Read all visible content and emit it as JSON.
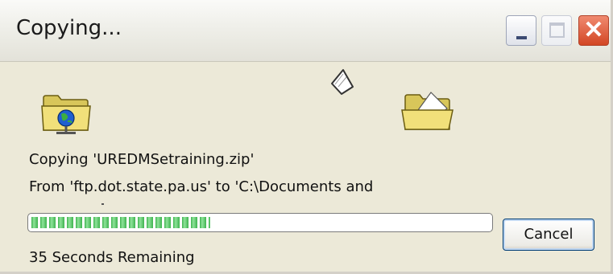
{
  "window": {
    "title": "Copying..."
  },
  "titlebar_buttons": {
    "minimize_icon": "minimize-icon",
    "maximize_icon": "maximize-icon",
    "close_icon": "close-icon",
    "close_glyph": "✕"
  },
  "animation": {
    "source_icon": "ftp-folder-icon",
    "flying_icon": "document-icon",
    "destination_icon": "open-folder-icon"
  },
  "status": {
    "copying_line": "Copying 'UREDMSetraining.zip'",
    "from_line": "From 'ftp.dot.state.pa.us' to 'C:\\Documents and",
    "remaining": "35 Seconds Remaining"
  },
  "progress": {
    "fraction": 0.39,
    "color": "#3fb34f"
  },
  "buttons": {
    "cancel_label": "Cancel"
  }
}
